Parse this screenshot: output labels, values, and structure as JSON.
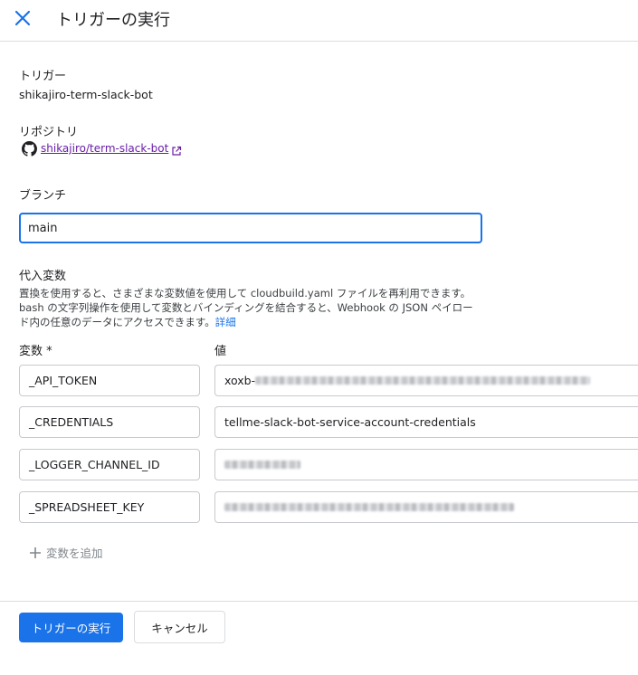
{
  "header": {
    "title": "トリガーの実行"
  },
  "trigger": {
    "label": "トリガー",
    "value": "shikajiro-term-slack-bot"
  },
  "repository": {
    "label": "リポジトリ",
    "link_text": "shikajiro/term-slack-bot"
  },
  "branch": {
    "label": "ブランチ",
    "value": "main"
  },
  "substitutions": {
    "label": "代入変数",
    "description": "置換を使用すると、さまざまな変数値を使用して cloudbuild.yaml ファイルを再利用できます。bash の文字列操作を使用して変数とバインディングを結合すると、Webhook の JSON ペイロード内の任意のデータにアクセスできます。",
    "details_link": "詳細",
    "variable_header": "変数 *",
    "value_header": "値",
    "rows": [
      {
        "key": "_API_TOKEN",
        "value": "xoxb-"
      },
      {
        "key": "_CREDENTIALS",
        "value": "tellme-slack-bot-service-account-credentials"
      },
      {
        "key": "_LOGGER_CHANNEL_ID",
        "value": ""
      },
      {
        "key": "_SPREADSHEET_KEY",
        "value": ""
      }
    ],
    "add_label": "変数を追加"
  },
  "actions": {
    "run_label": "トリガーの実行",
    "cancel_label": "キャンセル"
  },
  "colors": {
    "primary": "#1a73e8",
    "link_visited": "#681da8"
  }
}
